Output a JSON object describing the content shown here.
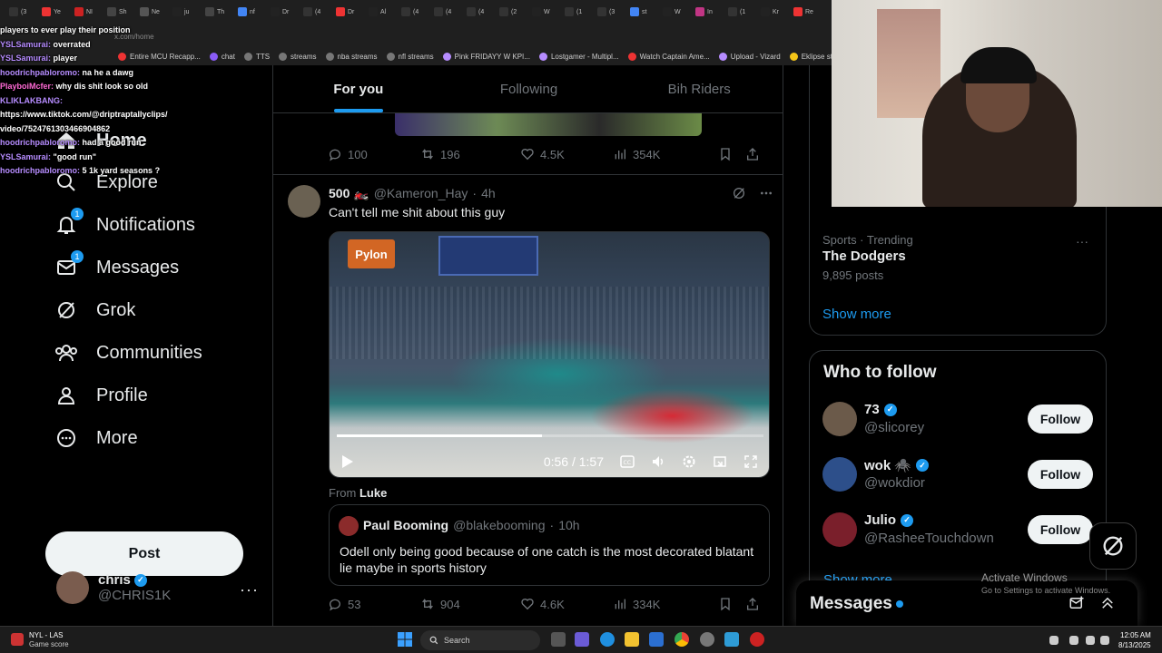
{
  "browser": {
    "tabs": [
      {
        "label": "(3",
        "color": "#333"
      },
      {
        "label": "Ye",
        "color": "#e33"
      },
      {
        "label": "NI",
        "color": "#c22"
      },
      {
        "label": "Sh",
        "color": "#444"
      },
      {
        "label": "Ne",
        "color": "#555"
      },
      {
        "label": "ju",
        "color": "#222"
      },
      {
        "label": "Th",
        "color": "#444"
      },
      {
        "label": "nf",
        "color": "#4285f4"
      },
      {
        "label": "Dr",
        "color": "#222"
      },
      {
        "label": "(4",
        "color": "#333"
      },
      {
        "label": "Dr",
        "color": "#e33"
      },
      {
        "label": "Al",
        "color": "#222"
      },
      {
        "label": "(4",
        "color": "#333"
      },
      {
        "label": "(4",
        "color": "#333"
      },
      {
        "label": "(4",
        "color": "#333"
      },
      {
        "label": "(2",
        "color": "#333"
      },
      {
        "label": "W",
        "color": "#222"
      },
      {
        "label": "(1",
        "color": "#333"
      },
      {
        "label": "(3",
        "color": "#333"
      },
      {
        "label": "st",
        "color": "#4285f4"
      },
      {
        "label": "W",
        "color": "#222"
      },
      {
        "label": "In",
        "color": "#c13584"
      },
      {
        "label": "(1",
        "color": "#333"
      },
      {
        "label": "Kr",
        "color": "#222"
      },
      {
        "label": "Re",
        "color": "#e33"
      }
    ],
    "url": "x.com/home",
    "bookmarks": [
      {
        "label": "Entire MCU Recapp...",
        "color": "#e33"
      },
      {
        "label": "chat",
        "color": "#8a5cf6"
      },
      {
        "label": "TTS",
        "color": "#777"
      },
      {
        "label": "streams",
        "color": "#777"
      },
      {
        "label": "nba streams",
        "color": "#777"
      },
      {
        "label": "nfl streams",
        "color": "#777"
      },
      {
        "label": "Pink FRIDAYY W KPI...",
        "color": "#b68cff"
      },
      {
        "label": "Lostgamer - Multipl...",
        "color": "#b68cff"
      },
      {
        "label": "Watch Captain Ame...",
        "color": "#e33"
      },
      {
        "label": "Upload - Vizard",
        "color": "#b68cff"
      },
      {
        "label": "Eklipse studio",
        "color": "#f5c518"
      }
    ]
  },
  "chat": [
    {
      "user": "",
      "text": "players to ever play their position"
    },
    {
      "user": "YSLSamurai:",
      "text": "overrated"
    },
    {
      "user": "YSLSamurai:",
      "text": "player"
    },
    {
      "user": "hoodrichpabloromo:",
      "text": "na he a dawg"
    },
    {
      "user": "PlayboiMcfer:",
      "text": "why dis shit look so old"
    },
    {
      "user": "KLIKLAKBANG:",
      "text": ""
    },
    {
      "user": "",
      "text": "https://www.tiktok.com/@driptraptallyclips/"
    },
    {
      "user": "",
      "text": "video/7524761303466904862"
    },
    {
      "user": "hoodrichpabloromo:",
      "text": "had a good run"
    },
    {
      "user": "YSLSamurai:",
      "text": "\"good run\""
    },
    {
      "user": "hoodrichpabloromo:",
      "text": "5 1k yard seasons ?"
    }
  ],
  "nav": {
    "home": "Home",
    "explore": "Explore",
    "notifications": "Notifications",
    "notifications_badge": "1",
    "messages": "Messages",
    "messages_badge": "1",
    "grok": "Grok",
    "communities": "Communities",
    "profile": "Profile",
    "more": "More",
    "post": "Post",
    "account_name": "chris",
    "account_handle": "@CHRIS1K",
    "account_more": "···"
  },
  "feed": {
    "tabs": [
      "For you",
      "Following",
      "Bih Riders"
    ],
    "prev_tweet_stats": {
      "replies": "100",
      "reposts": "196",
      "likes": "4.5K",
      "views": "354K"
    },
    "tweet": {
      "name": "500 🏍️",
      "handle": "@Kameron_Hay",
      "dot": "·",
      "time": "4h",
      "text": "Can't tell me shit about this guy",
      "video_badge": "Pylon",
      "video_time": "0:56 / 1:57",
      "video_progress": 0.48,
      "from_prefix": "From",
      "from_user": "Luke",
      "stats": {
        "replies": "53",
        "reposts": "904",
        "likes": "4.6K",
        "views": "334K"
      }
    },
    "quote": {
      "name": "Paul Booming",
      "handle": "@blakebooming",
      "dot": "·",
      "time": "10h",
      "text": "Odell only being good because of one catch is the most decorated blatant lie maybe in sports history"
    }
  },
  "sidebar": {
    "trend": {
      "category": "Sports · Trending",
      "title": "The Dodgers",
      "posts": "9,895 posts",
      "more": "···"
    },
    "show_more": "Show more",
    "who_to_follow": "Who to follow",
    "suggestions": [
      {
        "name": "73",
        "handle": "@slicorey",
        "button": "Follow",
        "color": "#6b5a4a"
      },
      {
        "name": "wok 🕷️",
        "handle": "@wokdior",
        "button": "Follow",
        "color": "#2d4f8a"
      },
      {
        "name": "Julio",
        "handle": "@RasheeTouchdown",
        "button": "Follow",
        "color": "#7a1f2b"
      }
    ],
    "show_more_2": "Show more",
    "messages": "Messages",
    "activate_title": "Activate Windows",
    "activate_sub": "Go to Settings to activate Windows."
  },
  "taskbar": {
    "weather_title": "NYL - LAS",
    "weather_sub": "Game score",
    "search": "Search",
    "time": "12:05 AM",
    "date": "8/13/2025"
  }
}
